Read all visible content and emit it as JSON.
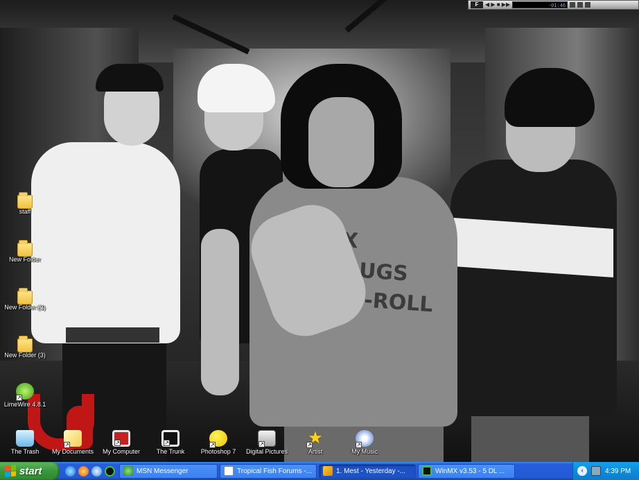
{
  "winamp": {
    "logo": "F",
    "display": "-01:46",
    "controls": "◀ ▶ ■ ▶▶"
  },
  "wallpaper": {
    "shirt_text": [
      "EX",
      "DRUGS",
      "K-N-ROLL"
    ]
  },
  "desktop": {
    "icons": [
      {
        "label": "staff",
        "icon": "folder-icon"
      },
      {
        "label": "New Folder",
        "icon": "folder-icon"
      },
      {
        "label": "New Folder (2)",
        "icon": "folder-icon"
      },
      {
        "label": "New Folder (3)",
        "icon": "folder-icon"
      },
      {
        "label": "LimeWire 4.8.1",
        "icon": "limewire-icon"
      },
      {
        "label": "The Trash",
        "icon": "recycle-bin-icon"
      },
      {
        "label": "My Documents",
        "icon": "my-documents-icon"
      },
      {
        "label": "My Computer",
        "icon": "my-computer-icon"
      },
      {
        "label": "The Trunk",
        "icon": "trunk-icon"
      },
      {
        "label": "Photoshop 7",
        "icon": "photoshop-icon"
      },
      {
        "label": "Digital Pictures",
        "icon": "digital-pictures-icon"
      },
      {
        "label": "Artist",
        "icon": "star-icon"
      },
      {
        "label": "My Music",
        "icon": "my-music-icon"
      }
    ]
  },
  "taskbar": {
    "start_label": "start",
    "quick_launch": [
      "internet-explorer-icon",
      "firefox-icon",
      "ie-alt-icon",
      "winmx-icon"
    ],
    "buttons": [
      {
        "label": "MSN Messenger",
        "icon": "msn-icon",
        "active": false
      },
      {
        "label": "Tropical Fish Forums -...",
        "icon": "browser-window-icon",
        "active": false
      },
      {
        "label": "1. Mest - Yesterday -...",
        "icon": "winamp-icon",
        "active": true
      },
      {
        "label": "WinMX v3.53  -  5 DL ...",
        "icon": "winmx-icon",
        "active": false
      }
    ],
    "clock": "4:39 PM"
  },
  "colors": {
    "taskbar_blue": "#245edb",
    "start_green": "#3a973a",
    "tray_blue": "#0d8bdc",
    "graffiti_red": "#c01616"
  }
}
